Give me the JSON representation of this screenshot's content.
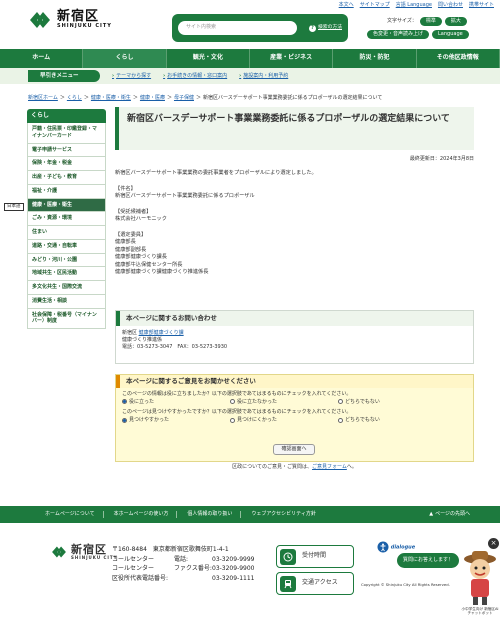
{
  "header": {
    "top_links": [
      "本文へ",
      "サイトマップ",
      "言語 Language",
      "問い合わせ",
      "携帯サイト"
    ],
    "logo_text": "新宿区",
    "logo_sub": "SHINJUKU CITY",
    "search_placeholder": "サイト内検索",
    "search_howto": "検索の方法",
    "font_size_label": "文字サイズ：",
    "font_std": "標準",
    "font_large": "拡大",
    "color_voice": "色変更・音声読み上げ",
    "language": "Language"
  },
  "main_nav": [
    "ホーム",
    "くらし",
    "観光・文化",
    "産業・ビジネス",
    "防災・防犯",
    "その他区政情報"
  ],
  "sub_nav": {
    "label": "早引きメニュー",
    "links": [
      "テーマから探す",
      "お手続きの情報・窓口案内",
      "施設案内・利用予約"
    ]
  },
  "breadcrumb": [
    "新宿区ホーム",
    "くらし",
    "健康・医療・衛生",
    "健康・医療",
    "母子保健",
    "新宿区バースデーサポート事業業務委託に係るプロポーザルの選定結果について"
  ],
  "sidebar": {
    "title": "くらし",
    "items": [
      "戸籍・住民票・印鑑登録・マイナンバーカード",
      "電子申請サービス",
      "保険・年金・税金",
      "出産・子ども・教育",
      "福祉・介護",
      "健康・医療・衛生",
      "ごみ・資源・環境",
      "住まい",
      "道路・交通・自転車",
      "みどり・河川・公園",
      "地域共生・区民活動",
      "多文化共生・国際交流",
      "消費生活・相談",
      "社会保障・税番号（マイナンバー）制度"
    ],
    "active_index": 5,
    "jp_badge": "日本語"
  },
  "page": {
    "title": "新宿区バースデーサポート事業業務委託に係るプロポーザルの選定結果について",
    "updated": "最終更新日：2024年3月8日",
    "intro": "新宿区バースデーサポート事業業務の委託事業者をプロポーザルにより選定しました。",
    "subject_label": "【件名】",
    "subject": "新宿区バースデーサポート事業業務委託に係るプロポーザル",
    "winner_label": "【受託候補者】",
    "winner": "株式会社ハーモニック",
    "committee_label": "【選定委員】",
    "committee": [
      "健康部長",
      "健康部副部長",
      "健康部健康づくり課長",
      "健康部牛込保健センター所長",
      "健康部健康づくり課健康づくり推進係長"
    ]
  },
  "inquiry": {
    "heading": "本ページに関するお問い合わせ",
    "dept_prefix": "新宿区",
    "dept_link": "健康部健康づくり課",
    "section": "健康づくり推進係",
    "phone": "電話：03-5273-3047　FAX：03-5273-3930"
  },
  "survey": {
    "heading": "本ページに関するご意見をお聞かせください",
    "q1": "このページの情報は役に立ちましたか？以下の選択肢であてはまるものにチェックを入れてください。",
    "q1_opts": [
      "役に立った",
      "役に立たなかった",
      "どちらでもない"
    ],
    "q2": "このページは見つけやすかったですか？以下の選択肢であてはまるものにチェックを入れてください。",
    "q2_opts": [
      "見つけやすかった",
      "見つけにくかった",
      "どちらでもない"
    ],
    "submit": "確認画面へ"
  },
  "note": {
    "text": "区政についてのご意見・ご質問は、",
    "link": "ご意見フォーム",
    "suffix": "へ。"
  },
  "footer": {
    "links": [
      "ホームページについて",
      "本ホームページの使い方",
      "個人情報の取り扱い",
      "ウェブアクセシビリティ方針"
    ],
    "pagetop": "ページの先頭へ",
    "logo_text": "新宿区",
    "logo_sub": "SHINJUKU CITY",
    "address": "〒160-8484　東京都新宿区歌舞伎町1-4-1",
    "rows": [
      {
        "k": "コールセンター",
        "m": "電話:",
        "v": "03-3209-9999"
      },
      {
        "k": "コールセンター",
        "m": "ファクス番号:",
        "v": "03-3209-9900"
      },
      {
        "k": "区役所代表電話番号:",
        "m": "",
        "v": "03-3209-1111"
      }
    ],
    "btn_hours": "受付時間",
    "btn_access": "交通アクセス",
    "copyright": "Copyright © Shinjuku City All Rights Reserved.",
    "chat": "質問にお答えします！",
    "dialog_badge": "dialogue",
    "mascot_label": "小中学生向け 新宿区AIチャットボット"
  }
}
